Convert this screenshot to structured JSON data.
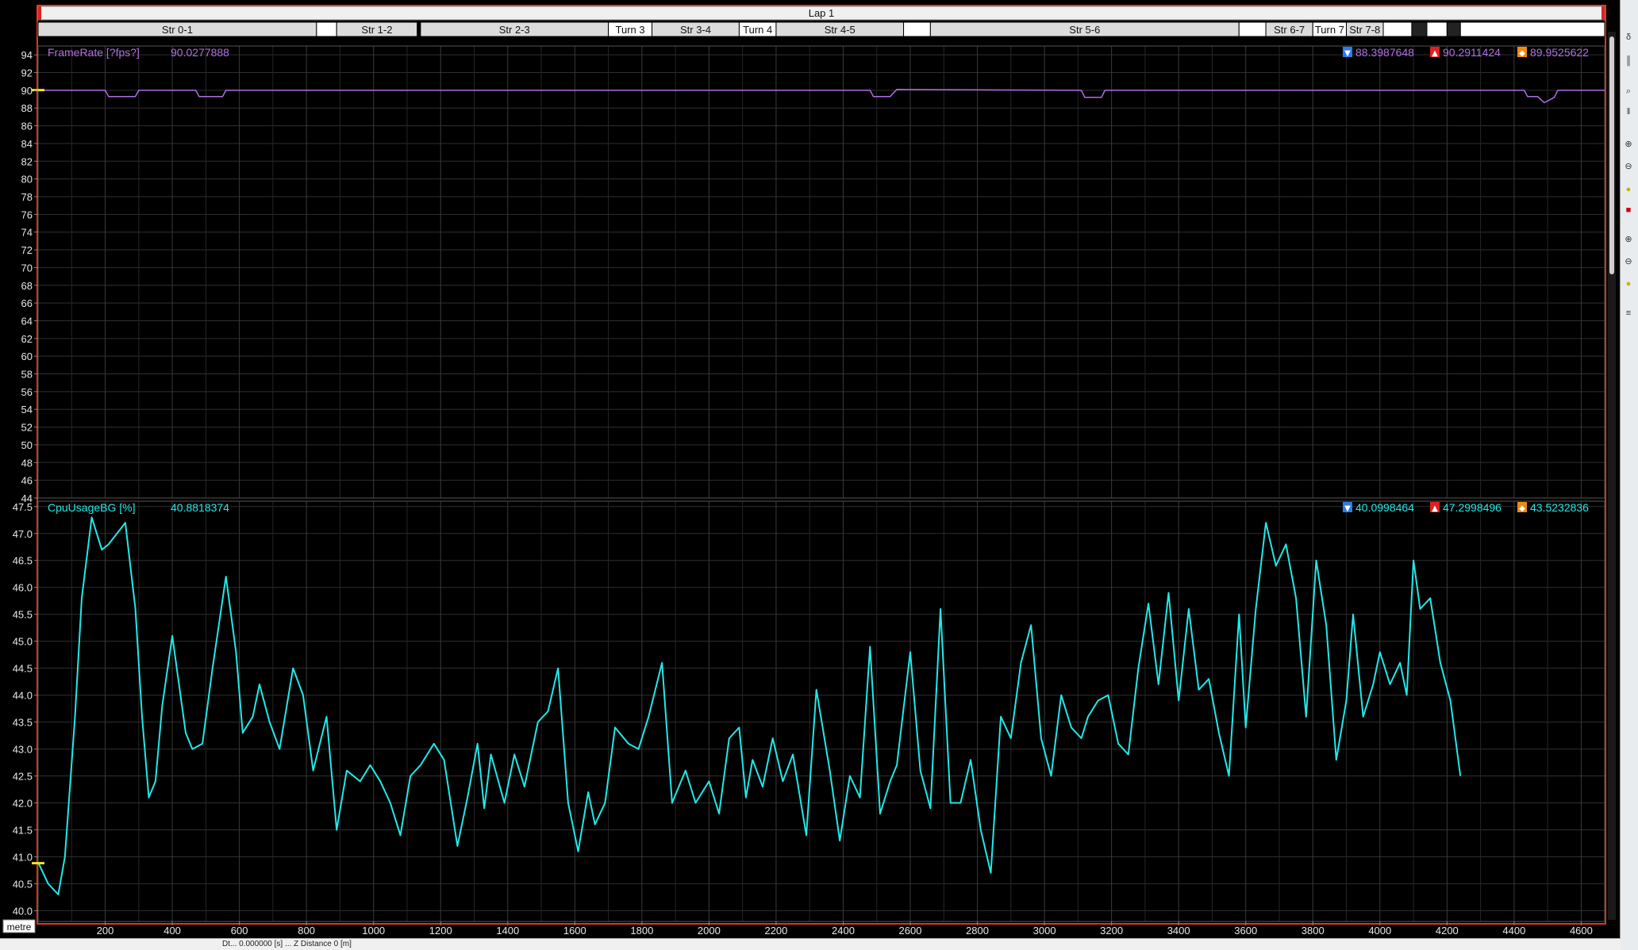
{
  "colors": {
    "background": "#000000",
    "grid": "#2f2f2f",
    "frame_border": "#d83a1e",
    "framerate_series": "#b070e0",
    "cpu_series": "#22e8e8",
    "cursor_marker": "#f0e020",
    "segment_bar": "#ffffff",
    "segment_dark": "#222222",
    "lap_bar": "#f0f0f0"
  },
  "lap_label": "Lap 1",
  "segments": [
    {
      "label": "Str 0-1",
      "from": 0,
      "to": 830,
      "style": "light"
    },
    {
      "label": "",
      "from": 830,
      "to": 890,
      "style": "white"
    },
    {
      "label": "Str 1-2",
      "from": 890,
      "to": 1130,
      "style": "light"
    },
    {
      "label": "Str 2-3",
      "from": 1140,
      "to": 1700,
      "style": "light"
    },
    {
      "label": "Turn 3",
      "from": 1700,
      "to": 1830,
      "style": "white"
    },
    {
      "label": "Str 3-4",
      "from": 1830,
      "to": 2090,
      "style": "light"
    },
    {
      "label": "Turn 4",
      "from": 2090,
      "to": 2200,
      "style": "white"
    },
    {
      "label": "Str 4-5",
      "from": 2200,
      "to": 2580,
      "style": "light"
    },
    {
      "label": "",
      "from": 2580,
      "to": 2660,
      "style": "white"
    },
    {
      "label": "Str 5-6",
      "from": 2660,
      "to": 3580,
      "style": "light"
    },
    {
      "label": "",
      "from": 3580,
      "to": 3660,
      "style": "white"
    },
    {
      "label": "Str 6-7",
      "from": 3660,
      "to": 3800,
      "style": "light"
    },
    {
      "label": "Turn 7",
      "from": 3800,
      "to": 3900,
      "style": "white"
    },
    {
      "label": "Str 7-8",
      "from": 3900,
      "to": 4010,
      "style": "light"
    },
    {
      "label": "",
      "from": 4010,
      "to": 4095,
      "style": "white"
    },
    {
      "label": "",
      "from": 4095,
      "to": 4140,
      "style": "dark"
    },
    {
      "label": "",
      "from": 4140,
      "to": 4200,
      "style": "white"
    },
    {
      "label": "",
      "from": 4200,
      "to": 4240,
      "style": "dark"
    },
    {
      "label": "",
      "from": 4240,
      "to": 4670,
      "style": "white"
    }
  ],
  "status_bar": {
    "left_text": "Dt... 0.000000 [s] ... Z Distance 0 [m]"
  },
  "chart_data": [
    {
      "type": "line",
      "name": "FrameRate [?fps?]",
      "current_value": "90.0277888",
      "stats": {
        "min": "88.3987648",
        "max": "90.2911424",
        "avg": "89.9525622"
      },
      "xlabel": "metre",
      "xlim": [
        0,
        4670
      ],
      "ylim": [
        44,
        95
      ],
      "y_ticks": [
        44,
        46,
        48,
        50,
        52,
        54,
        56,
        58,
        60,
        62,
        64,
        66,
        68,
        70,
        72,
        74,
        76,
        78,
        80,
        82,
        84,
        86,
        88,
        90,
        92,
        94
      ],
      "x": [
        0,
        200,
        210,
        290,
        300,
        470,
        480,
        550,
        560,
        2000,
        2480,
        2490,
        2540,
        2560,
        3110,
        3120,
        3170,
        3180,
        4430,
        4440,
        4470,
        4490,
        4520,
        4530,
        4670
      ],
      "values": [
        90.0,
        90.0,
        89.3,
        89.3,
        90.0,
        90.0,
        89.3,
        89.3,
        90.0,
        90.0,
        90.0,
        89.3,
        89.3,
        90.1,
        90.0,
        89.2,
        89.2,
        90.0,
        90.0,
        89.3,
        89.3,
        88.6,
        89.2,
        90.0,
        90.0
      ]
    },
    {
      "type": "line",
      "name": "CpuUsageBG [%]",
      "current_value": "40.8818374",
      "stats": {
        "min": "40.0998464",
        "max": "47.2998496",
        "avg": "43.5232836"
      },
      "xlabel": "metre",
      "xlim": [
        0,
        4670
      ],
      "ylim": [
        39.8,
        47.6
      ],
      "y_ticks": [
        40.0,
        40.5,
        41.0,
        41.5,
        42.0,
        42.5,
        43.0,
        43.5,
        44.0,
        44.5,
        45.0,
        45.5,
        46.0,
        46.5,
        47.0,
        47.5
      ],
      "x_ticks": [
        200,
        400,
        600,
        800,
        1000,
        1200,
        1400,
        1600,
        1800,
        2000,
        2200,
        2400,
        2600,
        2800,
        3000,
        3200,
        3400,
        3600,
        3800,
        4000,
        4200,
        4400,
        4600
      ],
      "x": [
        0,
        30,
        60,
        80,
        110,
        130,
        160,
        190,
        210,
        260,
        290,
        310,
        330,
        350,
        370,
        400,
        440,
        460,
        490,
        520,
        560,
        590,
        610,
        640,
        660,
        690,
        720,
        760,
        790,
        820,
        860,
        890,
        920,
        960,
        990,
        1020,
        1050,
        1080,
        1110,
        1140,
        1180,
        1210,
        1250,
        1280,
        1310,
        1330,
        1350,
        1390,
        1420,
        1450,
        1490,
        1520,
        1550,
        1580,
        1610,
        1640,
        1660,
        1690,
        1720,
        1760,
        1790,
        1820,
        1860,
        1890,
        1930,
        1960,
        2000,
        2030,
        2060,
        2090,
        2110,
        2130,
        2160,
        2190,
        2220,
        2250,
        2290,
        2320,
        2360,
        2390,
        2420,
        2450,
        2480,
        2510,
        2540,
        2560,
        2600,
        2630,
        2660,
        2690,
        2720,
        2750,
        2780,
        2810,
        2840,
        2870,
        2900,
        2930,
        2960,
        2990,
        3020,
        3050,
        3080,
        3110,
        3130,
        3160,
        3190,
        3220,
        3250,
        3280,
        3310,
        3340,
        3370,
        3400,
        3430,
        3460,
        3490,
        3520,
        3550,
        3580,
        3600,
        3630,
        3660,
        3690,
        3720,
        3750,
        3780,
        3810,
        3840,
        3870,
        3900,
        3920,
        3950,
        3980,
        4000,
        4030,
        4060,
        4080,
        4100,
        4120,
        4150,
        4180,
        4210,
        4240,
        4270,
        4300,
        4330,
        4360,
        4390,
        4420,
        4450,
        4480,
        4500,
        4530,
        4560,
        4590,
        4620,
        4650,
        4670
      ],
      "values": [
        40.9,
        40.5,
        40.3,
        41.0,
        43.6,
        45.8,
        47.3,
        46.7,
        46.8,
        47.2,
        45.6,
        43.6,
        42.1,
        42.4,
        43.8,
        45.1,
        43.3,
        43.0,
        43.1,
        44.5,
        46.2,
        44.8,
        43.3,
        43.6,
        44.2,
        43.5,
        43.0,
        44.5,
        44.0,
        42.6,
        43.6,
        41.5,
        42.6,
        42.4,
        42.7,
        42.4,
        42.0,
        41.4,
        42.5,
        42.7,
        43.1,
        42.8,
        41.2,
        42.1,
        43.1,
        41.9,
        42.9,
        42.0,
        42.9,
        42.3,
        43.5,
        43.7,
        44.5,
        42.0,
        41.1,
        42.2,
        41.6,
        42.0,
        43.4,
        43.1,
        43.0,
        43.6,
        44.6,
        42.0,
        42.6,
        42.0,
        42.4,
        41.8,
        43.2,
        43.4,
        42.1,
        42.8,
        42.3,
        43.2,
        42.4,
        42.9,
        41.4,
        44.1,
        42.6,
        41.3,
        42.5,
        42.1,
        44.9,
        41.8,
        42.4,
        42.7,
        44.8,
        42.6,
        41.9,
        45.6,
        42.0,
        42.0,
        42.8,
        41.5,
        40.7,
        43.6,
        43.2,
        44.6,
        45.3,
        43.2,
        42.5,
        44.0,
        43.4,
        43.2,
        43.6,
        43.9,
        44.0,
        43.1,
        42.9,
        44.5,
        45.7,
        44.2,
        45.9,
        43.9,
        45.6,
        44.1,
        44.3,
        43.3,
        42.5,
        45.5,
        43.4,
        45.6,
        47.2,
        46.4,
        46.8,
        45.8,
        43.6,
        46.5,
        45.3,
        42.8,
        43.9,
        45.5,
        43.6,
        44.2,
        44.8,
        44.2,
        44.6,
        44.0,
        46.5,
        45.6,
        45.8,
        44.6,
        43.9,
        42.5
      ]
    }
  ]
}
